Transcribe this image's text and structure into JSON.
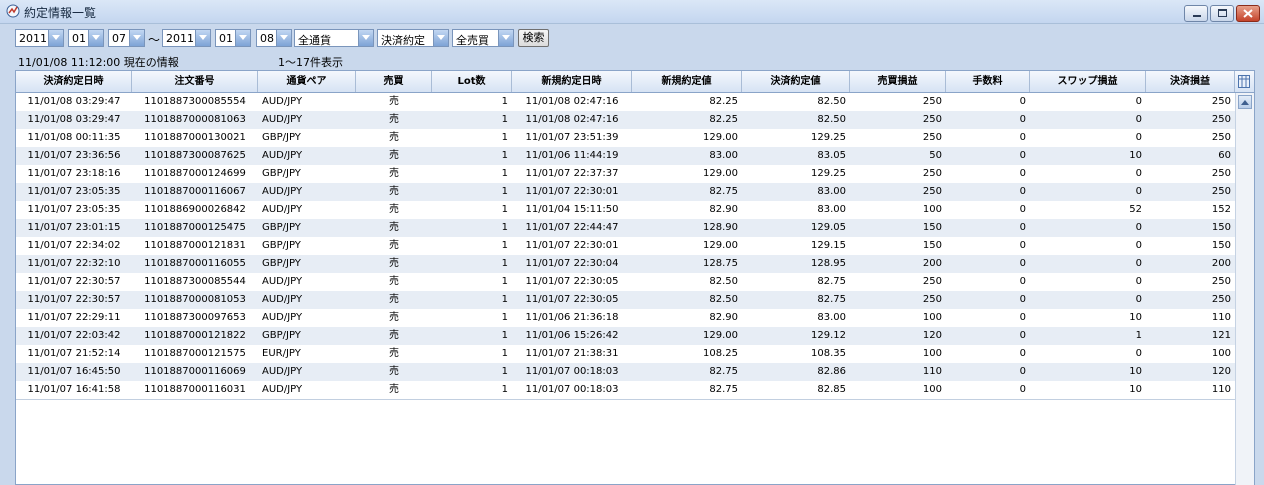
{
  "window": {
    "title": "約定情報一覧",
    "icon": "app-icon",
    "controls": [
      "minimize-icon",
      "maximize-icon",
      "close-icon"
    ]
  },
  "filters": {
    "from_year": "2011",
    "from_month": "01",
    "from_day": "07",
    "separator": "～",
    "to_year": "2011",
    "to_month": "01",
    "to_day": "08",
    "currency": "全通貨",
    "trade_type": "決済約定",
    "side": "全売買",
    "search_label": "検索"
  },
  "info": {
    "timestamp": "11/01/08 11:12:00 現在の情報",
    "count": "1～17件表示"
  },
  "columns": [
    "決済約定日時",
    "注文番号",
    "通貨ペア",
    "売買",
    "Lot数",
    "新規約定日時",
    "新規約定値",
    "決済約定値",
    "売買損益",
    "手数料",
    "スワップ損益",
    "決済損益"
  ],
  "rows": [
    [
      "11/01/08 03:29:47",
      "1101887300085554",
      "AUD/JPY",
      "売",
      "1",
      "11/01/08 02:47:16",
      "82.25",
      "82.50",
      "250",
      "0",
      "0",
      "250"
    ],
    [
      "11/01/08 03:29:47",
      "1101887000081063",
      "AUD/JPY",
      "売",
      "1",
      "11/01/08 02:47:16",
      "82.25",
      "82.50",
      "250",
      "0",
      "0",
      "250"
    ],
    [
      "11/01/08 00:11:35",
      "1101887000130021",
      "GBP/JPY",
      "売",
      "1",
      "11/01/07 23:51:39",
      "129.00",
      "129.25",
      "250",
      "0",
      "0",
      "250"
    ],
    [
      "11/01/07 23:36:56",
      "1101887300087625",
      "AUD/JPY",
      "売",
      "1",
      "11/01/06 11:44:19",
      "83.00",
      "83.05",
      "50",
      "0",
      "10",
      "60"
    ],
    [
      "11/01/07 23:18:16",
      "1101887000124699",
      "GBP/JPY",
      "売",
      "1",
      "11/01/07 22:37:37",
      "129.00",
      "129.25",
      "250",
      "0",
      "0",
      "250"
    ],
    [
      "11/01/07 23:05:35",
      "1101887000116067",
      "AUD/JPY",
      "売",
      "1",
      "11/01/07 22:30:01",
      "82.75",
      "83.00",
      "250",
      "0",
      "0",
      "250"
    ],
    [
      "11/01/07 23:05:35",
      "1101886900026842",
      "AUD/JPY",
      "売",
      "1",
      "11/01/04 15:11:50",
      "82.90",
      "83.00",
      "100",
      "0",
      "52",
      "152"
    ],
    [
      "11/01/07 23:01:15",
      "1101887000125475",
      "GBP/JPY",
      "売",
      "1",
      "11/01/07 22:44:47",
      "128.90",
      "129.05",
      "150",
      "0",
      "0",
      "150"
    ],
    [
      "11/01/07 22:34:02",
      "1101887000121831",
      "GBP/JPY",
      "売",
      "1",
      "11/01/07 22:30:01",
      "129.00",
      "129.15",
      "150",
      "0",
      "0",
      "150"
    ],
    [
      "11/01/07 22:32:10",
      "1101887000116055",
      "GBP/JPY",
      "売",
      "1",
      "11/01/07 22:30:04",
      "128.75",
      "128.95",
      "200",
      "0",
      "0",
      "200"
    ],
    [
      "11/01/07 22:30:57",
      "1101887300085544",
      "AUD/JPY",
      "売",
      "1",
      "11/01/07 22:30:05",
      "82.50",
      "82.75",
      "250",
      "0",
      "0",
      "250"
    ],
    [
      "11/01/07 22:30:57",
      "1101887000081053",
      "AUD/JPY",
      "売",
      "1",
      "11/01/07 22:30:05",
      "82.50",
      "82.75",
      "250",
      "0",
      "0",
      "250"
    ],
    [
      "11/01/07 22:29:11",
      "1101887300097653",
      "AUD/JPY",
      "売",
      "1",
      "11/01/06 21:36:18",
      "82.90",
      "83.00",
      "100",
      "0",
      "10",
      "110"
    ],
    [
      "11/01/07 22:03:42",
      "1101887000121822",
      "GBP/JPY",
      "売",
      "1",
      "11/01/06 15:26:42",
      "129.00",
      "129.12",
      "120",
      "0",
      "1",
      "121"
    ],
    [
      "11/01/07 21:52:14",
      "1101887000121575",
      "EUR/JPY",
      "売",
      "1",
      "11/01/07 21:38:31",
      "108.25",
      "108.35",
      "100",
      "0",
      "0",
      "100"
    ],
    [
      "11/01/07 16:45:50",
      "1101887000116069",
      "AUD/JPY",
      "売",
      "1",
      "11/01/07 00:18:03",
      "82.75",
      "82.86",
      "110",
      "0",
      "10",
      "120"
    ],
    [
      "11/01/07 16:41:58",
      "1101887000116031",
      "AUD/JPY",
      "売",
      "1",
      "11/01/07 00:18:03",
      "82.75",
      "82.85",
      "100",
      "0",
      "10",
      "110"
    ]
  ],
  "colors": {
    "title_bg": "#c4d6ef",
    "alt_row": "#e7edf5",
    "close_button": "#c4432b"
  }
}
